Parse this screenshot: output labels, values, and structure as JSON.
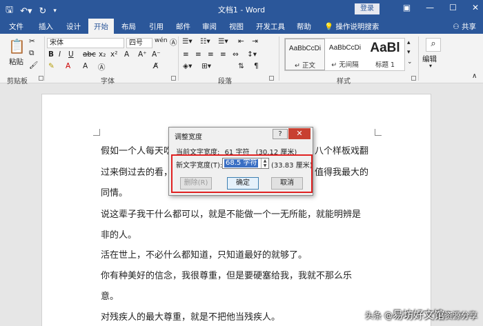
{
  "titlebar": {
    "quick_access": [
      "save-icon",
      "undo-icon",
      "redo-icon"
    ],
    "title": "文档1 - Word",
    "login": "登录",
    "window_controls": [
      "—",
      "☐",
      "✕"
    ]
  },
  "ribbon_tabs": [
    "文件",
    "插入",
    "设计",
    "开始",
    "布局",
    "引用",
    "邮件",
    "审阅",
    "视图",
    "开发工具",
    "帮助"
  ],
  "active_tab": "开始",
  "tell_me": "操作说明搜索",
  "share": "共享",
  "ribbon": {
    "clipboard": {
      "paste": "粘贴",
      "label": "剪贴板"
    },
    "font": {
      "name": "宋体",
      "size": "四号",
      "label": "字体"
    },
    "paragraph": {
      "label": "段落"
    },
    "styles": {
      "items": [
        {
          "sample": "AaBbCcDi",
          "name": "↵ 正文"
        },
        {
          "sample": "AaBbCcDi",
          "name": "↵ 无间隔"
        },
        {
          "sample": "AaBl",
          "name": "标题 1"
        }
      ],
      "label": "样式"
    },
    "editing": {
      "label": "编辑"
    }
  },
  "document": {
    "lines": [
      "假如一个人每天吃",
      "过来倒过去的看，",
      "同情。",
      "说这辈子我干什么都可以，就是不能做一个一无所能，就能明辨是",
      "非的人。",
      "活在世上，不必什么都知道，只知道最好的就够了。",
      "你有种美好的信念，我很尊重，但是要硬塞给我，我就不那么乐",
      "意。",
      "对残疾人的最大尊重，就是不把他当残疾人。"
    ],
    "right_fragments": [
      "八个样板戏翻",
      "值得我最大的"
    ]
  },
  "dialog": {
    "title": "调整宽度",
    "help": "?",
    "close": "✕",
    "current_label": "当前文字宽度:",
    "current_chars": "61 字符",
    "current_cm": "(30.12 厘米)",
    "new_label": "新文字宽度(T):",
    "new_value": "68.5 字符",
    "new_cm": "(33.83 厘米)",
    "btn_delete": "删除(R)",
    "btn_ok": "确定",
    "btn_cancel": "取消"
  },
  "watermark": {
    "prefix": "头条 @",
    "text": "易坊好文馆",
    "suffix": "资源分享"
  },
  "colors": {
    "word_blue": "#2b579a",
    "highlight_red": "#e02020",
    "selection": "#3a6fc4"
  }
}
